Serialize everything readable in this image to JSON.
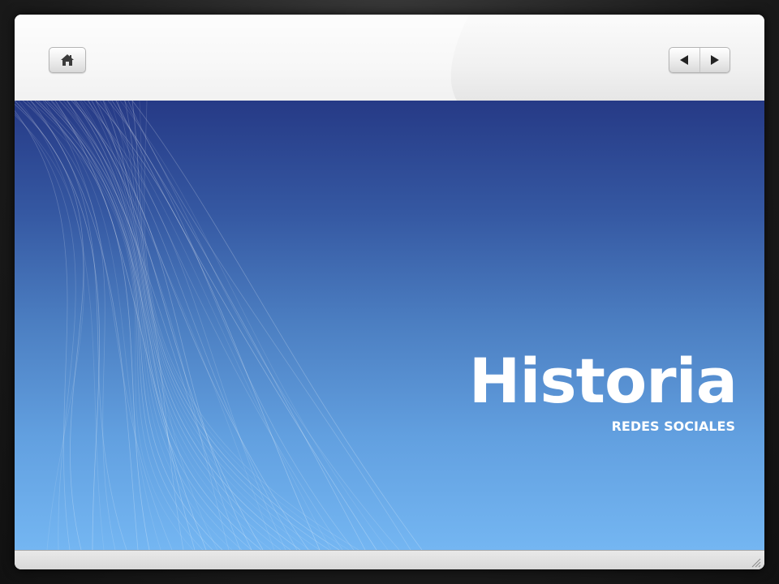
{
  "slide": {
    "title": "Historia",
    "subtitle": "REDES SOCIALES"
  },
  "icons": {
    "home": "home-icon",
    "prev": "triangle-left-icon",
    "next": "triangle-right-icon",
    "grip": "resize-grip-icon"
  },
  "colors": {
    "gradient_top": "#263a86",
    "gradient_bottom": "#74b6f2",
    "text": "#ffffff",
    "frame": "#ececec"
  }
}
